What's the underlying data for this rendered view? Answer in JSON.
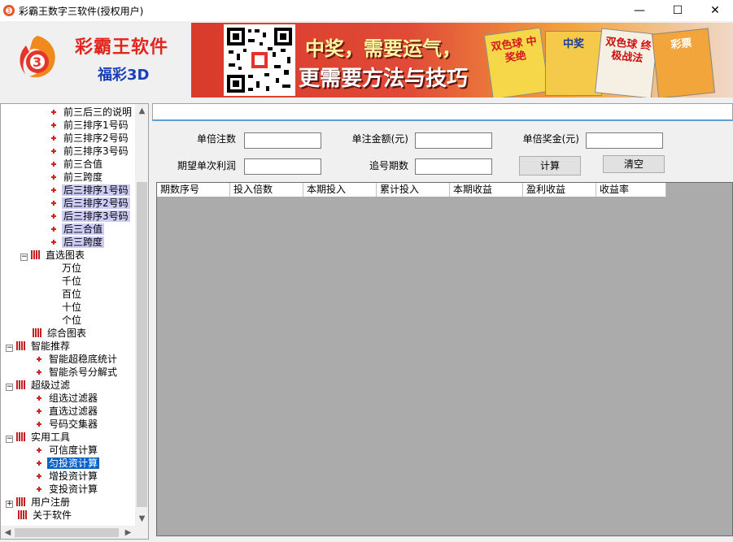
{
  "window": {
    "title": "彩霸王数字三软件(授权用户)",
    "controls": {
      "minimize": "—",
      "maximize": "☐",
      "close": "✕"
    }
  },
  "header": {
    "brand_name": "彩霸王软件",
    "brand_sub": "福彩3D",
    "banner": {
      "slogan_line1": "中奖，需要运气，",
      "slogan_line2": "更需要方法与技巧",
      "book_titles": [
        "双色球 中奖绝",
        "中奖",
        "双色球 终极战法",
        "彩票"
      ]
    }
  },
  "tree": {
    "items": [
      {
        "label": "前三后三的说明",
        "level": 2,
        "kind": "leaf"
      },
      {
        "label": "前三排序1号码",
        "level": 2,
        "kind": "leaf"
      },
      {
        "label": "前三排序2号码",
        "level": 2,
        "kind": "leaf"
      },
      {
        "label": "前三排序3号码",
        "level": 2,
        "kind": "leaf"
      },
      {
        "label": "前三合值",
        "level": 2,
        "kind": "leaf"
      },
      {
        "label": "前三跨度",
        "level": 2,
        "kind": "leaf"
      },
      {
        "label": "后三排序1号码",
        "level": 2,
        "kind": "leaf",
        "highlight": "lite"
      },
      {
        "label": "后三排序2号码",
        "level": 2,
        "kind": "leaf",
        "highlight": "lite"
      },
      {
        "label": "后三排序3号码",
        "level": 2,
        "kind": "leaf",
        "highlight": "lite"
      },
      {
        "label": "后三合值",
        "level": 2,
        "kind": "leaf",
        "highlight": "lite"
      },
      {
        "label": "后三跨度",
        "level": 2,
        "kind": "leaf",
        "highlight": "lite"
      },
      {
        "label": "直选图表",
        "level": 1,
        "kind": "folder",
        "expander": "−"
      },
      {
        "label": "万位",
        "level": 2,
        "kind": "plain"
      },
      {
        "label": "千位",
        "level": 2,
        "kind": "plain"
      },
      {
        "label": "百位",
        "level": 2,
        "kind": "plain"
      },
      {
        "label": "十位",
        "level": 2,
        "kind": "plain"
      },
      {
        "label": "个位",
        "level": 2,
        "kind": "plain"
      },
      {
        "label": "综合图表",
        "level": 1,
        "kind": "folder"
      },
      {
        "label": "智能推荐",
        "level": 0,
        "kind": "folder",
        "expander": "−"
      },
      {
        "label": "智能超稳底统计",
        "level": 1,
        "kind": "leaf"
      },
      {
        "label": "智能杀号分解式",
        "level": 1,
        "kind": "leaf"
      },
      {
        "label": "超级过滤",
        "level": 0,
        "kind": "folder",
        "expander": "−"
      },
      {
        "label": "组选过滤器",
        "level": 1,
        "kind": "leaf"
      },
      {
        "label": "直选过滤器",
        "level": 1,
        "kind": "leaf"
      },
      {
        "label": "号码交集器",
        "level": 1,
        "kind": "leaf"
      },
      {
        "label": "实用工具",
        "level": 0,
        "kind": "folder",
        "expander": "−"
      },
      {
        "label": "可信度计算",
        "level": 1,
        "kind": "leaf"
      },
      {
        "label": "匀投资计算",
        "level": 1,
        "kind": "leaf",
        "highlight": "sel"
      },
      {
        "label": "增投资计算",
        "level": 1,
        "kind": "leaf"
      },
      {
        "label": "变投资计算",
        "level": 1,
        "kind": "leaf"
      },
      {
        "label": "用户注册",
        "level": 0,
        "kind": "folder",
        "expander": "+"
      },
      {
        "label": "关于软件",
        "level": 0,
        "kind": "folder"
      }
    ],
    "scroll_up": "▲",
    "scroll_down": "▼",
    "scroll_left": "◀",
    "scroll_right": "▶"
  },
  "form": {
    "bet_count_label": "单倍注数",
    "bet_amount_label": "单注金额(元)",
    "prize_label": "单倍奖金(元)",
    "expected_profit_label": "期望单次利润",
    "periods_label": "追号期数",
    "bet_count_value": "",
    "bet_amount_value": "",
    "prize_value": "",
    "expected_profit_value": "",
    "periods_value": "",
    "calc_button": "计算",
    "clear_button": "清空"
  },
  "grid": {
    "columns": [
      "期数序号",
      "投入倍数",
      "本期投入",
      "累计投入",
      "本期收益",
      "盈利收益",
      "收益率"
    ]
  }
}
